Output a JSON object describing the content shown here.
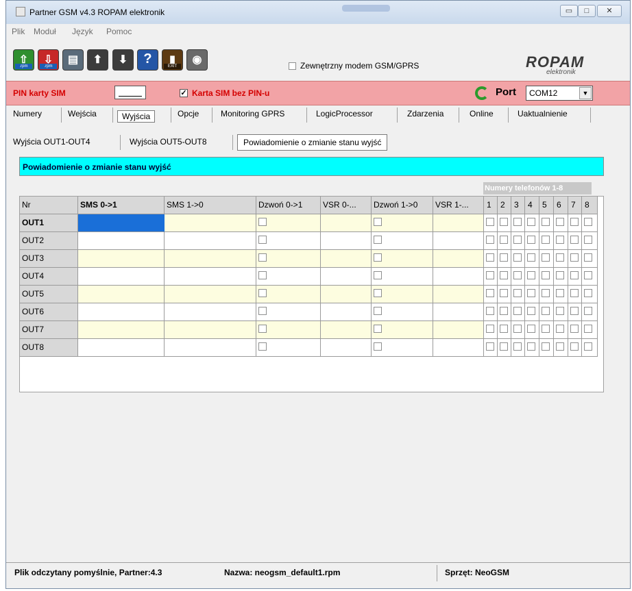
{
  "window": {
    "title": "Partner GSM v4.3 ROPAM elektronik"
  },
  "menu": [
    "Plik",
    "Moduł",
    "Język",
    "Pomoc"
  ],
  "toolbar": {
    "buttons": [
      {
        "name": "open-file-button",
        "icon": "upload-arrow-icon",
        "label": ".rpm",
        "color": "#2f8f2f"
      },
      {
        "name": "save-file-button",
        "icon": "download-arrow-icon",
        "label": ".rpm",
        "color": "#c62828"
      },
      {
        "name": "read-module-button",
        "icon": "module-read-icon",
        "label": "",
        "color": "#5a6b7a"
      },
      {
        "name": "upload-module-button",
        "icon": "module-upload-icon",
        "label": "",
        "color": "#4a4a4a"
      },
      {
        "name": "download-module-button",
        "icon": "module-download-icon",
        "label": "",
        "color": "#4a4a4a"
      },
      {
        "name": "help-button",
        "icon": "help-icon",
        "label": "",
        "color": "#2456a6"
      },
      {
        "name": "exit-button",
        "icon": "exit-door-icon",
        "label": "EXIT",
        "color": "#5d3a12"
      },
      {
        "name": "wireless-button",
        "icon": "wireless-icon",
        "label": "",
        "color": "#6a6a6a"
      }
    ],
    "external_modem_label": "Zewnętrzny modem GSM/GPRS",
    "external_modem_checked": false
  },
  "logo": {
    "brand": "ROPAM",
    "sub": "elektronik"
  },
  "pin": {
    "label": "PIN karty SIM",
    "value": "",
    "no_pin_checkbox_label": "Karta SIM bez PIN-u",
    "no_pin_checked": true,
    "port_label": "Port",
    "port_value": "COM12"
  },
  "tabs": [
    "Numery",
    "Wejścia",
    "Wyjścia",
    "Opcje",
    "Monitoring GPRS",
    "LogicProcessor",
    "Zdarzenia",
    "Online",
    "Uaktualnienie"
  ],
  "active_tab": "Wyjścia",
  "subtabs": [
    "Wyjścia OUT1-OUT4",
    "Wyjścia OUT5-OUT8",
    "Powiadomienie o zmianie stanu wyjść"
  ],
  "active_subtab": "Powiadomienie o zmianie stanu wyjść",
  "section_title": "Powiadomienie o zmianie stanu wyjść",
  "phone_numbers_header": "Numery telefonów 1-8",
  "table": {
    "columns": [
      "Nr",
      "SMS 0->1",
      "SMS 1->0",
      "Dzwoń 0->1",
      "VSR 0-...",
      "Dzwoń 1->0",
      "VSR 1-...",
      "1",
      "2",
      "3",
      "4",
      "5",
      "6",
      "7",
      "8"
    ],
    "rows": [
      {
        "nr": "OUT1",
        "sms01": "",
        "sms10": "",
        "call01": false,
        "vsr01": "",
        "call10": false,
        "vsr10": "",
        "phones": [
          false,
          false,
          false,
          false,
          false,
          false,
          false,
          false
        ]
      },
      {
        "nr": "OUT2",
        "sms01": "",
        "sms10": "",
        "call01": false,
        "vsr01": "",
        "call10": false,
        "vsr10": "",
        "phones": [
          false,
          false,
          false,
          false,
          false,
          false,
          false,
          false
        ]
      },
      {
        "nr": "OUT3",
        "sms01": "",
        "sms10": "",
        "call01": false,
        "vsr01": "",
        "call10": false,
        "vsr10": "",
        "phones": [
          false,
          false,
          false,
          false,
          false,
          false,
          false,
          false
        ]
      },
      {
        "nr": "OUT4",
        "sms01": "",
        "sms10": "",
        "call01": false,
        "vsr01": "",
        "call10": false,
        "vsr10": "",
        "phones": [
          false,
          false,
          false,
          false,
          false,
          false,
          false,
          false
        ]
      },
      {
        "nr": "OUT5",
        "sms01": "",
        "sms10": "",
        "call01": false,
        "vsr01": "",
        "call10": false,
        "vsr10": "",
        "phones": [
          false,
          false,
          false,
          false,
          false,
          false,
          false,
          false
        ]
      },
      {
        "nr": "OUT6",
        "sms01": "",
        "sms10": "",
        "call01": false,
        "vsr01": "",
        "call10": false,
        "vsr10": "",
        "phones": [
          false,
          false,
          false,
          false,
          false,
          false,
          false,
          false
        ]
      },
      {
        "nr": "OUT7",
        "sms01": "",
        "sms10": "",
        "call01": false,
        "vsr01": "",
        "call10": false,
        "vsr10": "",
        "phones": [
          false,
          false,
          false,
          false,
          false,
          false,
          false,
          false
        ]
      },
      {
        "nr": "OUT8",
        "sms01": "",
        "sms10": "",
        "call01": false,
        "vsr01": "",
        "call10": false,
        "vsr10": "",
        "phones": [
          false,
          false,
          false,
          false,
          false,
          false,
          false,
          false
        ]
      }
    ]
  },
  "status": {
    "message": "Plik odczytany pomyślnie, Partner:4.3",
    "filename": "Nazwa: neogsm_default1.rpm",
    "hardware": "Sprzęt: NeoGSM"
  },
  "colors": {
    "pin_bar": "#f2a3a6",
    "pin_text": "#d40000",
    "section_header": "#00ffff",
    "row_alt": "#fdfde0",
    "selection": "#1a6fd8"
  }
}
